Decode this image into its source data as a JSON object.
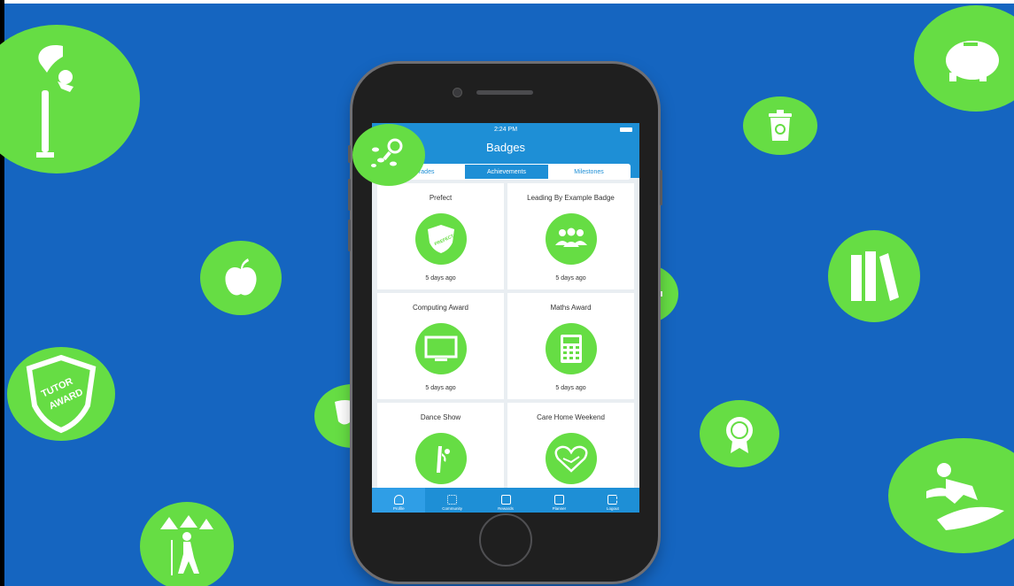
{
  "app": {
    "status_time": "2:24 PM",
    "title": "Badges"
  },
  "segments": [
    {
      "label": "Grades",
      "active": false
    },
    {
      "label": "Achievements",
      "active": true
    },
    {
      "label": "Milestones",
      "active": false
    }
  ],
  "badges": [
    {
      "title": "Prefect",
      "time": "5 days ago",
      "icon": "prefect-shield-icon"
    },
    {
      "title": "Leading By Example Badge",
      "time": "5 days ago",
      "icon": "group-icon"
    },
    {
      "title": "Computing Award",
      "time": "5 days ago",
      "icon": "monitor-icon"
    },
    {
      "title": "Maths Award",
      "time": "5 days ago",
      "icon": "calculator-icon"
    },
    {
      "title": "Dance Show",
      "time": "",
      "icon": "dancer-icon"
    },
    {
      "title": "Care Home Weekend",
      "time": "",
      "icon": "heart-hands-icon"
    }
  ],
  "tabbar": [
    {
      "label": "Profile",
      "active": true
    },
    {
      "label": "Community",
      "active": false
    },
    {
      "label": "Rewards",
      "active": false
    },
    {
      "label": "Planner",
      "active": false
    },
    {
      "label": "Logout",
      "active": false
    }
  ],
  "shield_text": {
    "prefect": "PREFECT",
    "tutor_line1": "TUTOR",
    "tutor_line2": "AWARD"
  },
  "colors": {
    "background": "#1565c0",
    "badge_green": "#66dd44",
    "app_blue": "#1e8fd6"
  }
}
